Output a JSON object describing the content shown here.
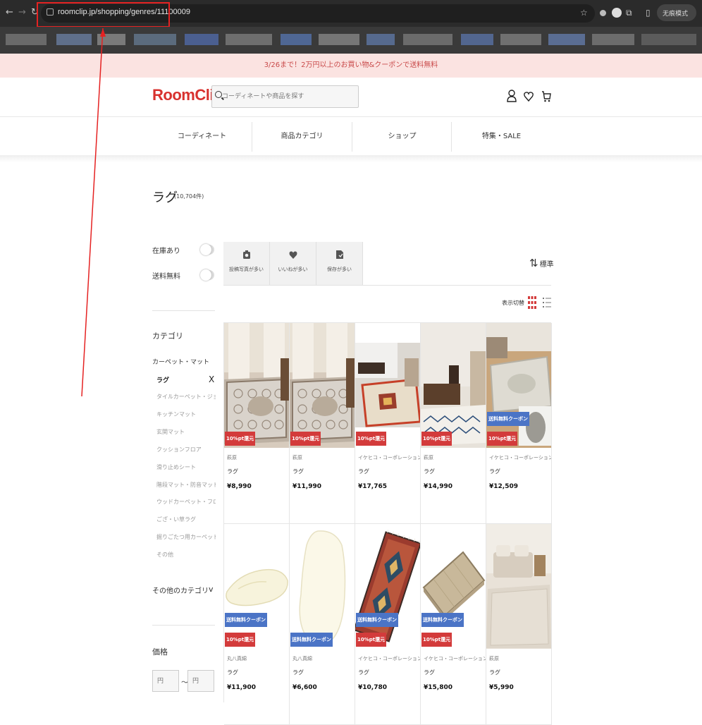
{
  "browser": {
    "url": "roomclip.jp/shopping/genres/11100009",
    "incognito_label": "无痕模式",
    "colors": {
      "annotation": "#e52222"
    }
  },
  "promo": {
    "text": "3/26まで！2万円以上のお買い物&クーポンで送料無料"
  },
  "header": {
    "logo": "RoomClip",
    "search_placeholder": "コーディネートや商品を探す",
    "icons": [
      "user-icon",
      "heart-icon",
      "cart-icon"
    ]
  },
  "global_nav": [
    "コーディネート",
    "商品カテゴリ",
    "ショップ",
    "特集・SALE"
  ],
  "page": {
    "title": "ラグ",
    "count": "(10,704件)"
  },
  "filters": {
    "in_stock": "在庫あり",
    "free_shipping": "送料無料",
    "category_heading": "カテゴリ",
    "category_parent": "カーペット・マット",
    "category_active": "ラグ",
    "category_clear": "X",
    "category_items": [
      "タイルカーペット・ジョイントマット",
      "キッチンマット",
      "玄関マット",
      "クッションフロア",
      "滑り止めシート",
      "階段マット・防音マット",
      "ウッドカーペット・フロアマット",
      "ござ・い草ラグ",
      "掘りごたつ用カーペット",
      "その他"
    ],
    "other_categories": "その他のカテゴリ",
    "other_chevron": "v",
    "price_heading": "価格",
    "price_min_placeholder": "円",
    "price_max_placeholder": "円",
    "price_separator": "〜"
  },
  "sort_tabs": [
    {
      "icon": "camera-icon",
      "label": "投稿写真が多い"
    },
    {
      "icon": "heart-icon",
      "label": "いいねが多い"
    },
    {
      "icon": "bookmark-icon",
      "label": "保存が多い"
    }
  ],
  "sort": {
    "label": "標準"
  },
  "view_switch": {
    "label": "表示切替"
  },
  "products": [
    {
      "shop": "萩原",
      "name": "ラグ",
      "price": "¥8,990",
      "badges": [
        "10%pt還元"
      ]
    },
    {
      "shop": "萩原",
      "name": "ラグ",
      "price": "¥11,990",
      "badges": [
        "10%pt還元"
      ]
    },
    {
      "shop": "イケヒコ・コーポレーション",
      "name": "ラグ",
      "price": "¥17,765",
      "badges": [
        "10%pt還元"
      ]
    },
    {
      "shop": "萩原",
      "name": "ラグ",
      "price": "¥14,990",
      "badges": [
        "10%pt還元"
      ]
    },
    {
      "shop": "イケヒコ・コーポレーション",
      "name": "ラグ",
      "price": "¥12,509",
      "badges": [
        "送料無料クーポン",
        "10%pt還元"
      ]
    },
    {
      "shop": "丸八真綿",
      "name": "ラグ",
      "price": "¥11,900",
      "badges": [
        "送料無料クーポン",
        "10%pt還元"
      ]
    },
    {
      "shop": "丸八真綿",
      "name": "ラグ",
      "price": "¥6,600",
      "badges": [
        "送料無料クーポン"
      ]
    },
    {
      "shop": "イケヒコ・コーポレーション",
      "name": "ラグ",
      "price": "¥10,780",
      "badges": [
        "送料無料クーポン",
        "10%pt還元"
      ]
    },
    {
      "shop": "イケヒコ・コーポレーション",
      "name": "ラグ",
      "price": "¥15,800",
      "badges": [
        "送料無料クーポン",
        "10%pt還元"
      ]
    },
    {
      "shop": "萩原",
      "name": "ラグ",
      "price": "¥5,990",
      "badges": []
    }
  ]
}
